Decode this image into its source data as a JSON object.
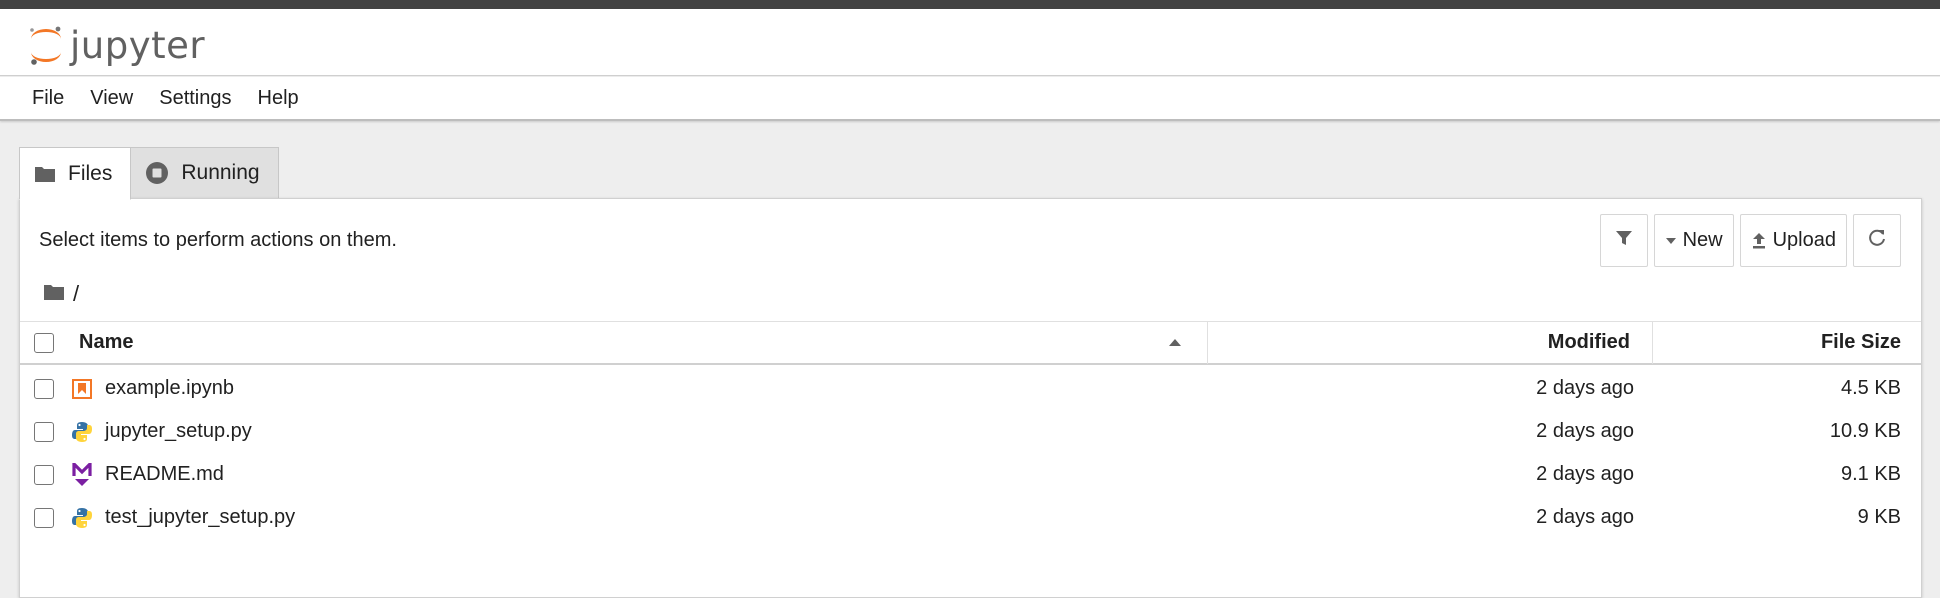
{
  "app": {
    "logo_text": "jupyter",
    "logo_icon": "jupyter-logo-icon"
  },
  "menu": {
    "items": [
      "File",
      "View",
      "Settings",
      "Help"
    ]
  },
  "tabs": [
    {
      "label": "Files",
      "icon": "folder-icon",
      "active": true
    },
    {
      "label": "Running",
      "icon": "stop-circle-icon",
      "active": false
    }
  ],
  "browser": {
    "hint": "Select items to perform actions on them.",
    "breadcrumb": "/",
    "toolbar": {
      "filter_icon": "filter-icon",
      "new_label": "New",
      "upload_label": "Upload",
      "refresh_icon": "refresh-icon"
    },
    "columns": {
      "name": "Name",
      "modified": "Modified",
      "size": "File Size"
    },
    "files": [
      {
        "name": "example.ipynb",
        "modified": "2 days ago",
        "size": "4.5 KB",
        "icon": "notebook-icon"
      },
      {
        "name": "jupyter_setup.py",
        "modified": "2 days ago",
        "size": "10.9 KB",
        "icon": "python-icon"
      },
      {
        "name": "README.md",
        "modified": "2 days ago",
        "size": "9.1 KB",
        "icon": "markdown-icon"
      },
      {
        "name": "test_jupyter_setup.py",
        "modified": "2 days ago",
        "size": "9 KB",
        "icon": "python-icon"
      }
    ]
  },
  "colors": {
    "jupyter_orange": "#f37726",
    "markdown_purple": "#7b1fa2",
    "python_blue": "#3572a5",
    "python_yellow": "#ffd43b"
  }
}
